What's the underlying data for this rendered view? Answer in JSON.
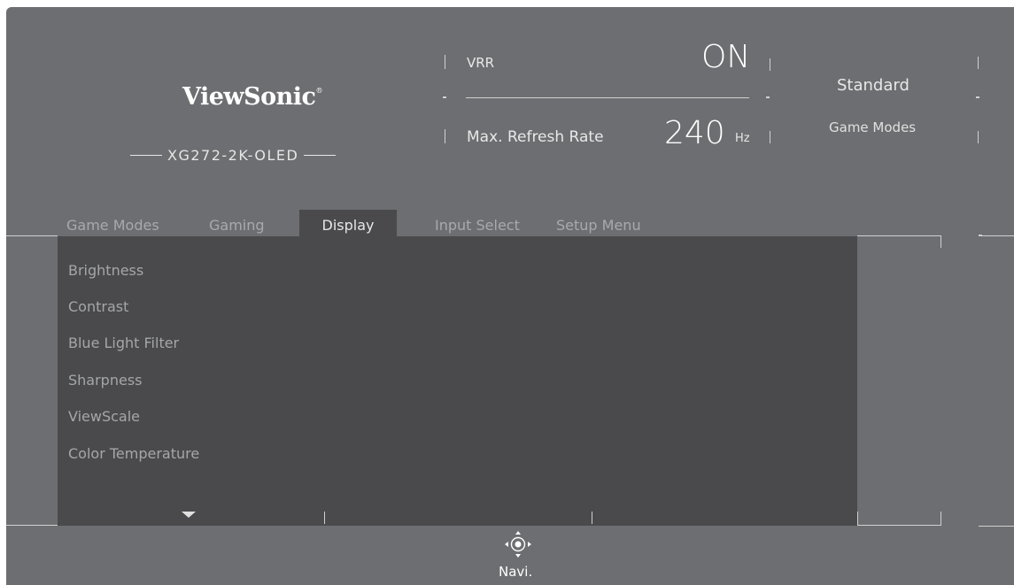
{
  "brand": {
    "logo": "ViewSonic",
    "reg_mark": "®",
    "model": "XG272-2K-OLED"
  },
  "status": {
    "vrr_label": "VRR",
    "vrr_value": "ON",
    "refresh_label": "Max. Refresh Rate",
    "refresh_value": "240",
    "refresh_unit": "Hz"
  },
  "game_mode": {
    "value": "Standard",
    "label": "Game Modes"
  },
  "tabs": [
    {
      "label": "Game Modes",
      "active": false
    },
    {
      "label": "Gaming",
      "active": false
    },
    {
      "label": "Display",
      "active": true
    },
    {
      "label": "Input Select",
      "active": false
    },
    {
      "label": "Setup Menu",
      "active": false
    }
  ],
  "menu": {
    "items": [
      "Brightness",
      "Contrast",
      "Blue Light Filter",
      "Sharpness",
      "ViewScale",
      "Color Temperature"
    ],
    "more_icon": "caret-down-icon"
  },
  "footer": {
    "navi_label": "Navi.",
    "navi_icon": "joystick-icon"
  },
  "colors": {
    "background": "#6d6e71",
    "panel": "#4a4a4c",
    "text": "#ffffff",
    "dim_text": "#a5a6a8"
  }
}
